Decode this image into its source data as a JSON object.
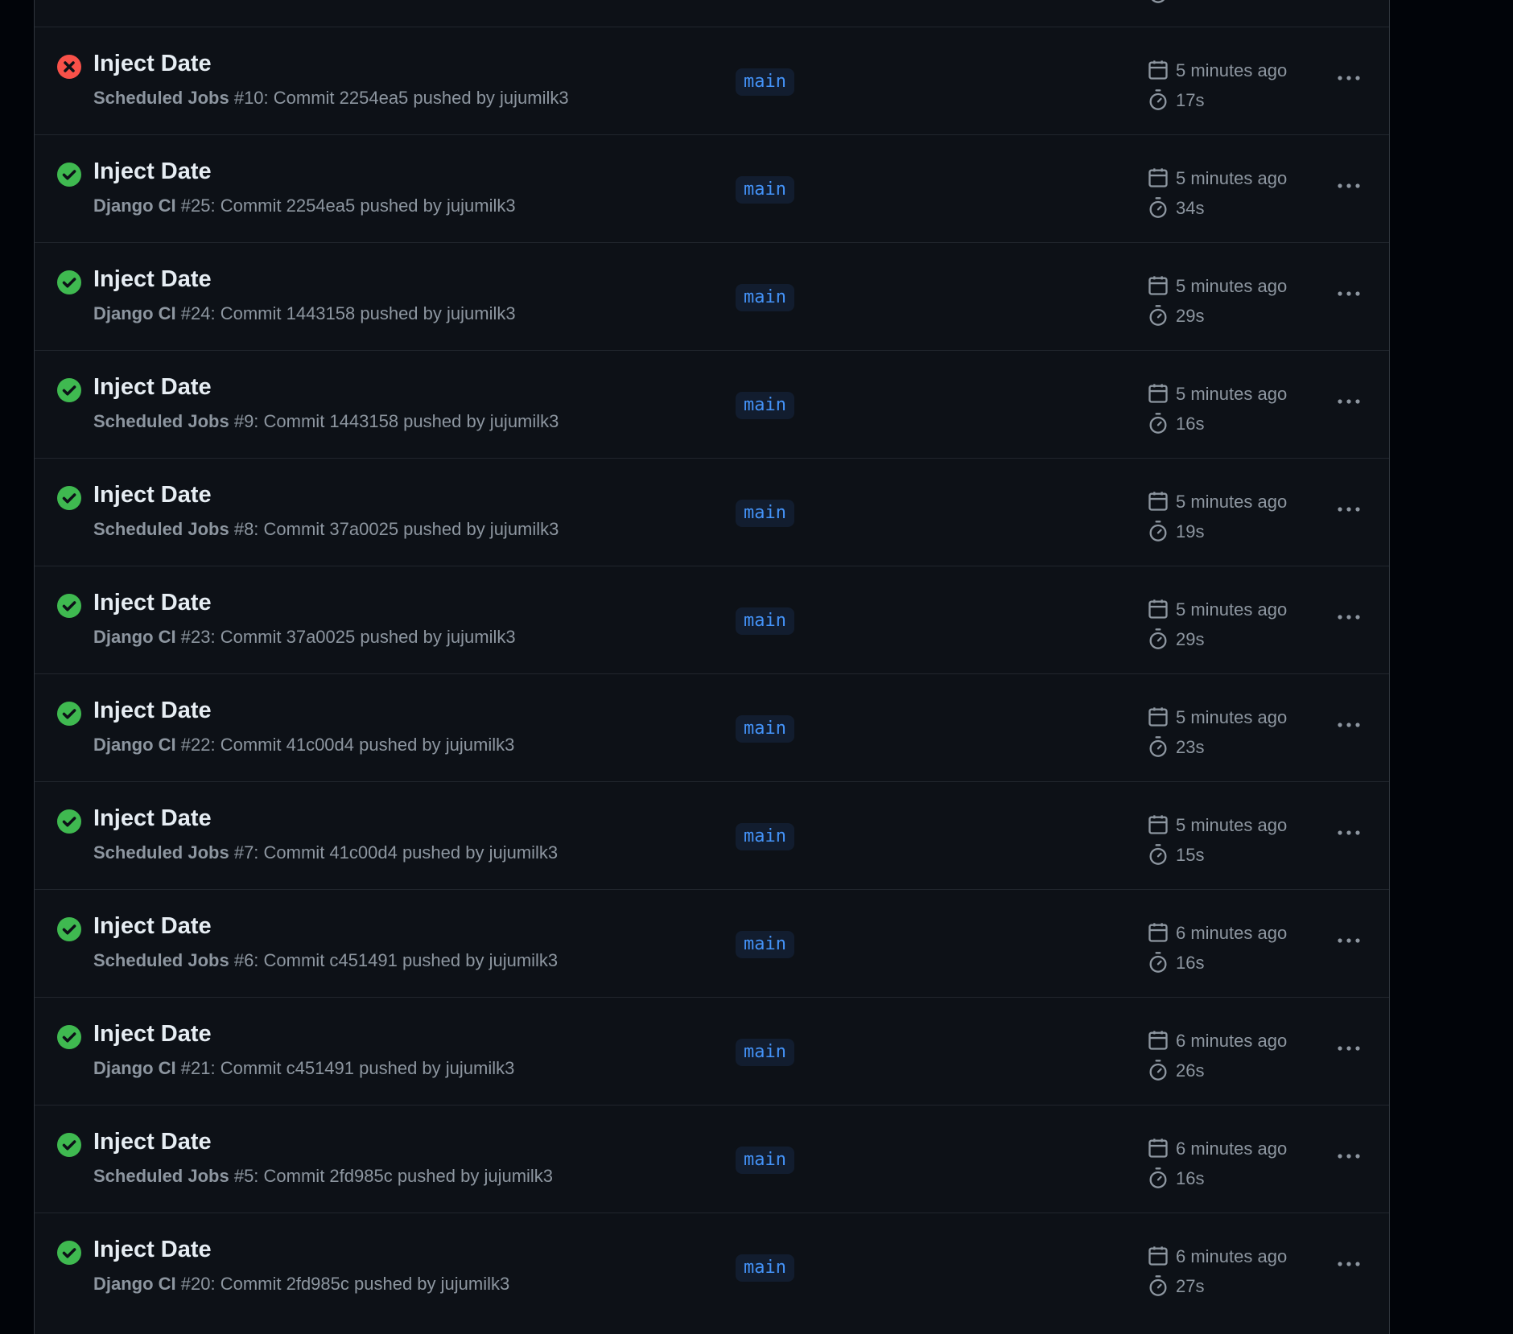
{
  "colors": {
    "success": "#3fb950",
    "failure": "#f85149",
    "branch_text": "#4493f8",
    "branch_bg": "#121d2f",
    "muted_text": "#8d96a0",
    "title_text": "#e6edf3"
  },
  "icons": {
    "success": "check-circle-icon",
    "failure": "x-circle-icon",
    "time": "calendar-icon",
    "duration": "stopwatch-icon",
    "menu": "kebab-horizontal-icon"
  },
  "runs": [
    {
      "status": "failure",
      "title": "Inject Date",
      "workflow": "Scheduled Jobs",
      "run_info": " #10: Commit 2254ea5 pushed by jujumilk3",
      "branch": "main",
      "time_ago": "5 minutes ago",
      "duration": "17s"
    },
    {
      "status": "success",
      "title": "Inject Date",
      "workflow": "Django CI",
      "run_info": " #25: Commit 2254ea5 pushed by jujumilk3",
      "branch": "main",
      "time_ago": "5 minutes ago",
      "duration": "34s"
    },
    {
      "status": "success",
      "title": "Inject Date",
      "workflow": "Django CI",
      "run_info": " #24: Commit 1443158 pushed by jujumilk3",
      "branch": "main",
      "time_ago": "5 minutes ago",
      "duration": "29s"
    },
    {
      "status": "success",
      "title": "Inject Date",
      "workflow": "Scheduled Jobs",
      "run_info": " #9: Commit 1443158 pushed by jujumilk3",
      "branch": "main",
      "time_ago": "5 minutes ago",
      "duration": "16s"
    },
    {
      "status": "success",
      "title": "Inject Date",
      "workflow": "Scheduled Jobs",
      "run_info": " #8: Commit 37a0025 pushed by jujumilk3",
      "branch": "main",
      "time_ago": "5 minutes ago",
      "duration": "19s"
    },
    {
      "status": "success",
      "title": "Inject Date",
      "workflow": "Django CI",
      "run_info": " #23: Commit 37a0025 pushed by jujumilk3",
      "branch": "main",
      "time_ago": "5 minutes ago",
      "duration": "29s"
    },
    {
      "status": "success",
      "title": "Inject Date",
      "workflow": "Django CI",
      "run_info": " #22: Commit 41c00d4 pushed by jujumilk3",
      "branch": "main",
      "time_ago": "5 minutes ago",
      "duration": "23s"
    },
    {
      "status": "success",
      "title": "Inject Date",
      "workflow": "Scheduled Jobs",
      "run_info": " #7: Commit 41c00d4 pushed by jujumilk3",
      "branch": "main",
      "time_ago": "5 minutes ago",
      "duration": "15s"
    },
    {
      "status": "success",
      "title": "Inject Date",
      "workflow": "Scheduled Jobs",
      "run_info": " #6: Commit c451491 pushed by jujumilk3",
      "branch": "main",
      "time_ago": "6 minutes ago",
      "duration": "16s"
    },
    {
      "status": "success",
      "title": "Inject Date",
      "workflow": "Django CI",
      "run_info": " #21: Commit c451491 pushed by jujumilk3",
      "branch": "main",
      "time_ago": "6 minutes ago",
      "duration": "26s"
    },
    {
      "status": "success",
      "title": "Inject Date",
      "workflow": "Scheduled Jobs",
      "run_info": " #5: Commit 2fd985c pushed by jujumilk3",
      "branch": "main",
      "time_ago": "6 minutes ago",
      "duration": "16s"
    },
    {
      "status": "success",
      "title": "Inject Date",
      "workflow": "Django CI",
      "run_info": " #20: Commit 2fd985c pushed by jujumilk3",
      "branch": "main",
      "time_ago": "6 minutes ago",
      "duration": "27s"
    }
  ]
}
